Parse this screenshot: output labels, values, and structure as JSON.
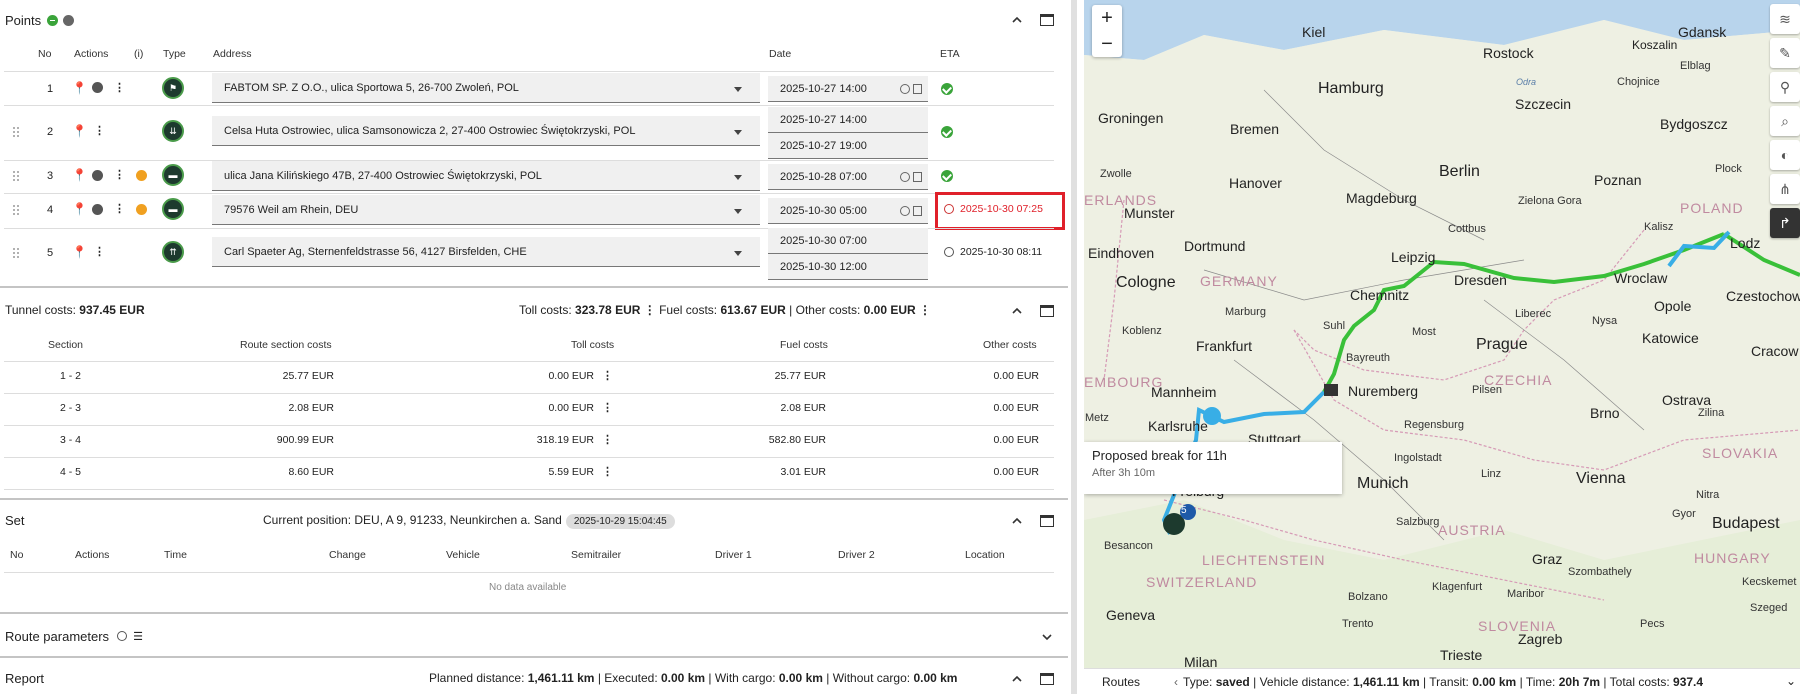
{
  "points": {
    "title": "Points",
    "columns": {
      "no": "No",
      "actions": "Actions",
      "info": "(i)",
      "type": "Type",
      "address": "Address",
      "date": "Date",
      "eta": "ETA"
    },
    "rows": [
      {
        "no": "1",
        "address": "FABTOM SP. Z O.O., ulica Sportowa 5, 26-700 Zwoleń, POL",
        "dates": [
          "2025-10-27 14:00"
        ],
        "eta": "",
        "eta_ok": true,
        "warn": false,
        "type_icon": "flag-icon",
        "type_glyph": "⚑"
      },
      {
        "no": "2",
        "address": "Celsa Huta Ostrowiec, ulica Samsonowicza 2, 27-400 Ostrowiec Świętokrzyski, POL",
        "dates": [
          "2025-10-27 14:00",
          "2025-10-27 19:00"
        ],
        "eta": "",
        "eta_ok": true,
        "warn": false,
        "type_icon": "loading-icon",
        "type_glyph": "⇊"
      },
      {
        "no": "3",
        "address": "ulica Jana Kilińskiego 47B, 27-400 Ostrowiec Świętokrzyski, POL",
        "dates": [
          "2025-10-28 07:00"
        ],
        "eta": "",
        "eta_ok": true,
        "warn": true,
        "type_icon": "customs-icon",
        "type_glyph": "▬"
      },
      {
        "no": "4",
        "address": "79576 Weil am Rhein, DEU",
        "dates": [
          "2025-10-30 05:00"
        ],
        "eta": "2025-10-30 07:25",
        "eta_ok": false,
        "warn": true,
        "type_icon": "customs-icon",
        "type_glyph": "▬"
      },
      {
        "no": "5",
        "address": "Carl Spaeter Ag, Sternenfeldstrasse 56, 4127 Birsfelden, CHE",
        "dates": [
          "2025-10-30 07:00",
          "2025-10-30 12:00"
        ],
        "eta": "2025-10-30 08:11",
        "eta_ok": false,
        "warn": false,
        "type_icon": "unloading-icon",
        "type_glyph": "⇈"
      }
    ]
  },
  "costs": {
    "tunnel_label": "Tunnel costs:",
    "tunnel_value": "937.45 EUR",
    "toll_label": "Toll costs:",
    "toll_value": "323.78 EUR",
    "fuel_label": "Fuel costs:",
    "fuel_value": "613.67 EUR",
    "other_label": "Other costs:",
    "other_value": "0.00 EUR",
    "columns": {
      "section": "Section",
      "route": "Route section costs",
      "toll": "Toll costs",
      "fuel": "Fuel costs",
      "other": "Other costs"
    },
    "rows": [
      {
        "section": "1 - 2",
        "route": "25.77 EUR",
        "toll": "0.00 EUR",
        "fuel": "25.77 EUR",
        "other": "0.00 EUR"
      },
      {
        "section": "2 - 3",
        "route": "2.08 EUR",
        "toll": "0.00 EUR",
        "fuel": "2.08 EUR",
        "other": "0.00 EUR"
      },
      {
        "section": "3 - 4",
        "route": "900.99 EUR",
        "toll": "318.19 EUR",
        "fuel": "582.80 EUR",
        "other": "0.00 EUR"
      },
      {
        "section": "4 - 5",
        "route": "8.60 EUR",
        "toll": "5.59 EUR",
        "fuel": "3.01 EUR",
        "other": "0.00 EUR"
      }
    ]
  },
  "set": {
    "title": "Set",
    "position_label": "Current position: DEU, A 9, 91233, Neunkirchen a. Sand",
    "position_time": "2025-10-29 15:04:45",
    "columns": {
      "no": "No",
      "actions": "Actions",
      "time": "Time",
      "change": "Change",
      "vehicle": "Vehicle",
      "semitrailer": "Semitrailer",
      "driver1": "Driver 1",
      "driver2": "Driver 2",
      "location": "Location"
    },
    "empty": "No data available"
  },
  "route_params": {
    "title": "Route parameters"
  },
  "report": {
    "title": "Report",
    "planned_label": "Planned distance:",
    "planned_value": "1,461.11 km",
    "executed_label": "Executed:",
    "executed_value": "0.00 km",
    "with_label": "With cargo:",
    "with_value": "0.00 km",
    "without_label": "Without cargo:",
    "without_value": "0.00 km"
  },
  "map": {
    "zoom_in": "+",
    "zoom_out": "−",
    "popup_title": "Proposed break for 11h",
    "popup_sub": "After 3h 10m",
    "marker_num": "5",
    "cities": [
      "Kiel",
      "Rostock",
      "Gdansk",
      "Koszalin",
      "Hamburg",
      "Szczecin",
      "Chojnice",
      "Elblag",
      "Groningen",
      "Bremen",
      "Bydgoszcz",
      "Zwolle",
      "Hanover",
      "Berlin",
      "Poznan",
      "Plock",
      "Munster",
      "Magdeburg",
      "Zielona Gora",
      "Kalisz",
      "Eindhoven",
      "Dortmund",
      "Cottbus",
      "Lodz",
      "Cologne",
      "Leipzig",
      "Dresden",
      "Wroclaw",
      "Opole",
      "Czestochowa",
      "Chemnitz",
      "Liberec",
      "Nysa",
      "Katowice",
      "Koblenz",
      "Marburg",
      "Suhl",
      "Most",
      "Prague",
      "Cracow",
      "Frankfurt",
      "Bayreuth",
      "Ostrava",
      "Mannheim",
      "Nuremberg",
      "Pilsen",
      "Brno",
      "Zilina",
      "Karlsruhe",
      "Stuttgart",
      "Regensburg",
      "Ingolstadt",
      "Linz",
      "Vienna",
      "Freiburg",
      "Munich",
      "Nitra",
      "Salzburg",
      "Gyor",
      "Budapest",
      "Besancon",
      "Geneva",
      "Bolzano",
      "Graz",
      "Klagenfurt",
      "Maribor",
      "Pecs",
      "Trento",
      "Zagreb",
      "Trieste",
      "Milan",
      "Szombathely",
      "Kecskemet",
      "Szeged",
      "Metz",
      "Odra"
    ],
    "countries": [
      "POLAND",
      "GERMANY",
      "CZECHIA",
      "SLOVAKIA",
      "AUSTRIA",
      "HUNGARY",
      "SWITZERLAND",
      "LIECHTENSTEIN",
      "SLOVENIA",
      "EMBOURG",
      "ERLANDS"
    ],
    "bottom": {
      "routes_label": "Routes",
      "type_label": "Type:",
      "type_value": "saved",
      "vdist_label": "Vehicle distance:",
      "vdist_value": "1,461.11 km",
      "transit_label": "Transit:",
      "transit_value": "0.00 km",
      "time_label": "Time:",
      "time_value": "20h 7m",
      "total_label": "Total costs:",
      "total_value": "937.4"
    }
  }
}
